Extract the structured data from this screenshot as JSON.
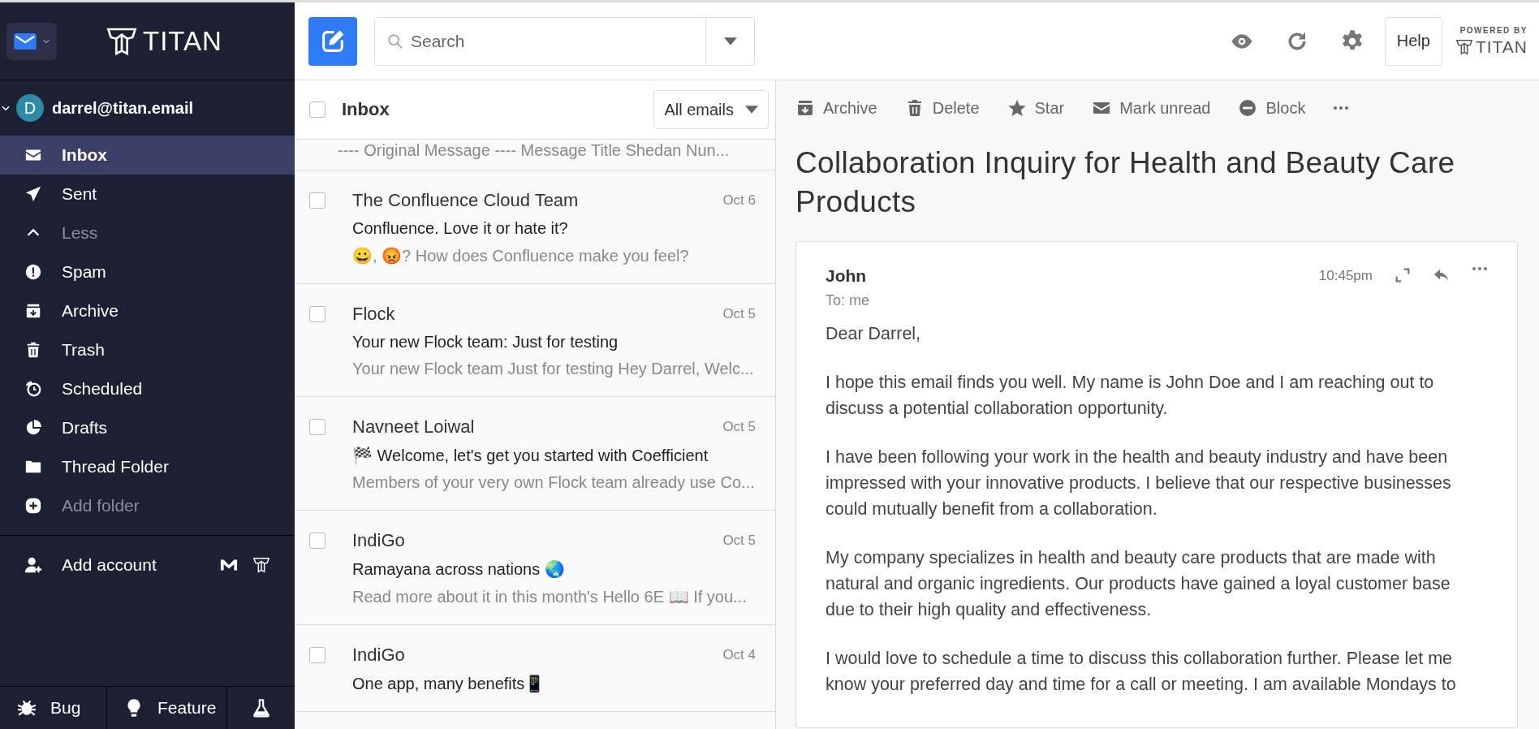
{
  "app": {
    "logo": "TITAN"
  },
  "search": {
    "placeholder": "Search"
  },
  "topbar": {
    "help": "Help",
    "powered_by": "POWERED BY",
    "brand": "TITAN"
  },
  "account": {
    "email": "darrel@titan.email",
    "initial": "D",
    "expanded": true
  },
  "folders": [
    {
      "kind": "inbox",
      "label": "Inbox",
      "selected": true
    },
    {
      "kind": "sent",
      "label": "Sent",
      "selected": false
    },
    {
      "kind": "less",
      "label": "Less",
      "selected": false
    },
    {
      "kind": "spam",
      "label": "Spam",
      "selected": false
    },
    {
      "kind": "archive",
      "label": "Archive",
      "selected": false
    },
    {
      "kind": "trash",
      "label": "Trash",
      "selected": false
    },
    {
      "kind": "scheduled",
      "label": "Scheduled",
      "selected": false
    },
    {
      "kind": "drafts",
      "label": "Drafts",
      "selected": false
    },
    {
      "kind": "folder",
      "label": "Thread Folder",
      "selected": false
    },
    {
      "kind": "add",
      "label": "Add folder",
      "selected": false
    }
  ],
  "add_account": {
    "label": "Add account"
  },
  "footer": [
    {
      "kind": "bug",
      "label": "Bug"
    },
    {
      "kind": "feature",
      "label": "Feature"
    },
    {
      "kind": "labs"
    }
  ],
  "list": {
    "title": "Inbox",
    "select_all": false,
    "filter": "All emails",
    "messages": [
      {
        "kind": "partial",
        "preview": "---- Original Message ---- Message Title Shedan Nun..."
      },
      {
        "kind": "full",
        "checked": false,
        "sender": "The Confluence Cloud Team",
        "date": "Oct 6",
        "subject": "Confluence. Love it or hate it?",
        "preview": "😀, 😡? How does Confluence make you feel?"
      },
      {
        "kind": "full",
        "checked": false,
        "sender": "Flock",
        "date": "Oct 5",
        "subject": "Your new Flock team: Just for testing",
        "preview": "Your new Flock team Just for testing Hey Darrel, Welc..."
      },
      {
        "kind": "full",
        "checked": false,
        "sender": "Navneet Loiwal",
        "date": "Oct 5",
        "subject": "🏁 Welcome, let's get you started with Coefficient",
        "preview": "Members of your very own Flock team already use Co..."
      },
      {
        "kind": "full",
        "checked": false,
        "sender": "IndiGo",
        "date": "Oct 5",
        "subject": "Ramayana across nations 🌏",
        "preview": "Read more about it in this month's Hello 6E 📖 If you..."
      },
      {
        "kind": "full",
        "checked": false,
        "sender": "IndiGo",
        "date": "Oct 4",
        "subject": "One app, many benefits📱"
      }
    ]
  },
  "reader": {
    "actions": [
      {
        "kind": "archive",
        "label": "Archive"
      },
      {
        "kind": "delete",
        "label": "Delete"
      },
      {
        "kind": "star",
        "label": "Star"
      },
      {
        "kind": "unread",
        "label": "Mark unread"
      },
      {
        "kind": "block",
        "label": "Block"
      },
      {
        "kind": "more"
      }
    ],
    "subject": "Collaboration Inquiry for Health and Beauty Care Products",
    "sender": "John",
    "to": "To: me",
    "time": "10:45pm",
    "body": [
      "Dear Darrel,",
      "I hope this email finds you well. My name is John Doe and I am reaching out to discuss a potential collaboration opportunity.",
      "I have been following your work in the health and beauty industry and have been impressed with your innovative products. I believe that our respective businesses could mutually benefit from a collaboration.",
      "My company specializes in health and beauty care products that are made with natural and organic ingredients. Our products have gained a loyal customer base due to their high quality and effectiveness.",
      "I would love to schedule a time to discuss this collaboration further. Please let me know your preferred day and time for a call or meeting. I am available Mondays to"
    ]
  }
}
